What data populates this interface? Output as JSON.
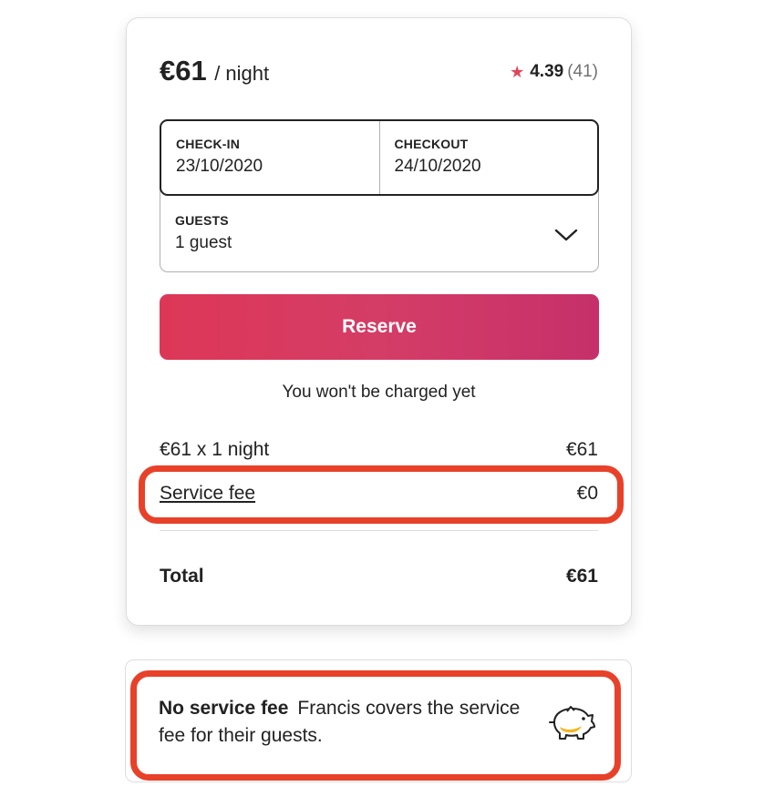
{
  "listing": {
    "price": "€61",
    "per_night": "/ night",
    "rating": "4.39",
    "review_count": "(41)"
  },
  "dates": {
    "checkin_label": "CHECK-IN",
    "checkin_value": "23/10/2020",
    "checkout_label": "CHECKOUT",
    "checkout_value": "24/10/2020"
  },
  "guests": {
    "label": "GUESTS",
    "value": "1 guest"
  },
  "reserve_label": "Reserve",
  "no_charge_note": "You won't be charged yet",
  "breakdown": {
    "nights_label": "€61 x 1 night",
    "nights_value": "€61",
    "fee_label": "Service fee",
    "fee_value": "€0",
    "total_label": "Total",
    "total_value": "€61"
  },
  "info": {
    "title": "No service fee",
    "text": "Francis covers the service fee for their guests."
  },
  "icons": {
    "rating": "star-icon",
    "guests_dropdown": "chevron-down-icon",
    "info": "piggy-bank-icon"
  },
  "colors": {
    "accent": "#e0455e",
    "reserve_start": "#dd3757",
    "reserve_end": "#c6306a",
    "highlight": "#e8412a"
  }
}
